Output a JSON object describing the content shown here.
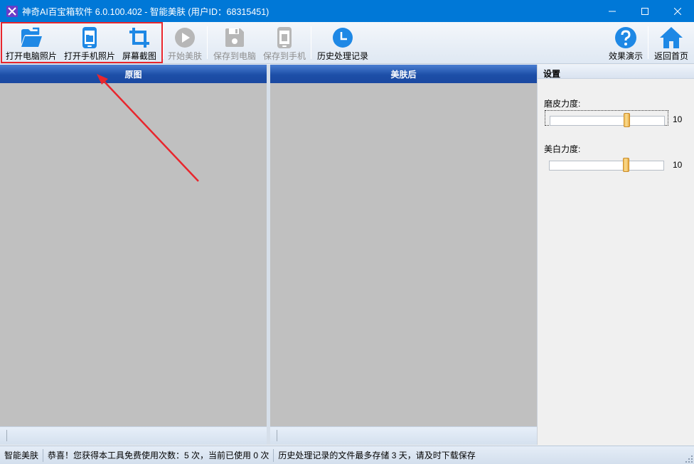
{
  "window": {
    "title": "神奇AI百宝箱软件 6.0.100.402 - 智能美肤 (用户ID：68315451)"
  },
  "toolbar": {
    "buttons": [
      {
        "label": "打开电脑照片",
        "icon": "folder-open-icon",
        "enabled": true
      },
      {
        "label": "打开手机照片",
        "icon": "phone-icon",
        "enabled": true
      },
      {
        "label": "屏幕截图",
        "icon": "crop-icon",
        "enabled": true
      },
      {
        "label": "开始美肤",
        "icon": "play-icon",
        "enabled": false
      },
      {
        "label": "保存到电脑",
        "icon": "save-disk-icon",
        "enabled": false
      },
      {
        "label": "保存到手机",
        "icon": "save-phone-icon",
        "enabled": false
      },
      {
        "label": "历史处理记录",
        "icon": "clock-icon",
        "enabled": true
      },
      {
        "label": "效果演示",
        "icon": "help-icon",
        "enabled": true
      },
      {
        "label": "返回首页",
        "icon": "home-icon",
        "enabled": true
      }
    ]
  },
  "panels": {
    "original": {
      "title": "原图"
    },
    "result": {
      "title": "美肤后"
    }
  },
  "settings": {
    "title": "设置",
    "smooth": {
      "label": "磨皮力度:",
      "value": "10",
      "fraction": 0.67
    },
    "whiten": {
      "label": "美白力度:",
      "value": "10",
      "fraction": 0.67
    }
  },
  "statusbar": {
    "module": "智能美肤",
    "quota": "恭喜！您获得本工具免费使用次数：5 次，当前已使用 0 次",
    "notice": "历史处理记录的文件最多存储 3 天，请及时下载保存"
  },
  "colors": {
    "titlebar": "#0078d7",
    "accent_blue": "#1e88e5",
    "highlight_red": "#e8262d",
    "panel_header": "#1d4fa8",
    "image_bg": "#c0c0c0"
  }
}
